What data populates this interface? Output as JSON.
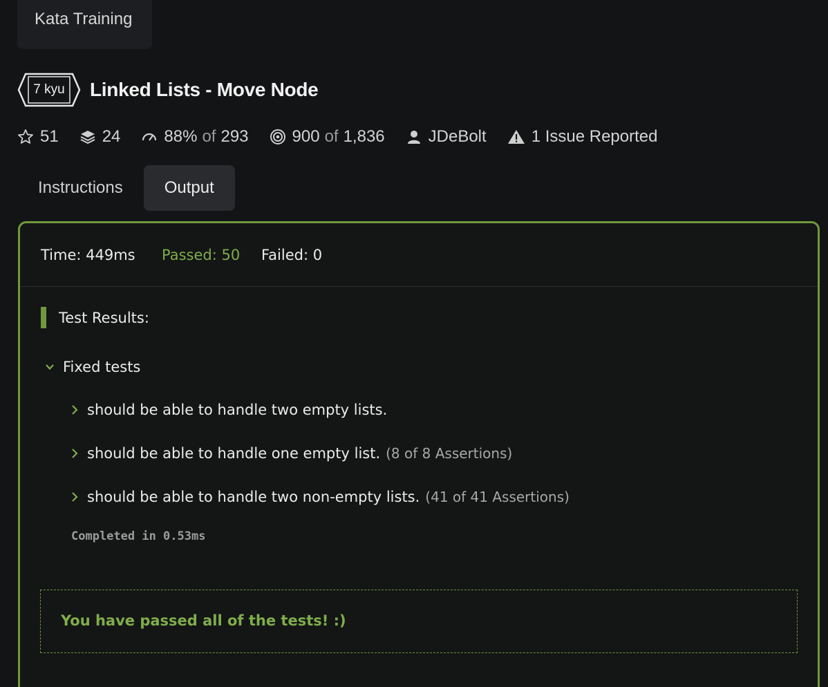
{
  "top_tab": {
    "label": "Kata Training"
  },
  "kata": {
    "rank": "7 kyu",
    "title": "Linked Lists - Move Node"
  },
  "stats": {
    "stars": "51",
    "collections": "24",
    "satisfaction_pct": "88%",
    "of_word": "of",
    "satisfaction_votes": "293",
    "completed": "900",
    "attempted": "1,836",
    "author": "JDeBolt",
    "issues": "1 Issue Reported"
  },
  "tabs": [
    {
      "label": "Instructions",
      "active": false
    },
    {
      "label": "Output",
      "active": true
    }
  ],
  "output": {
    "time": "Time: 449ms",
    "passed": "Passed: 50",
    "failed": "Failed: 0",
    "results_heading": "Test Results:",
    "group_label": "Fixed tests",
    "tests": [
      {
        "label": "should be able to handle two empty lists.",
        "assertions": ""
      },
      {
        "label": "should be able to handle one empty list.",
        "assertions": "(8 of 8 Assertions)"
      },
      {
        "label": "should be able to handle two non-empty lists.",
        "assertions": "(41 of 41 Assertions)"
      }
    ],
    "completed_in": "Completed in 0.53ms",
    "passed_message": "You have passed all of the tests! :)"
  },
  "colors": {
    "accent_green": "#6f9a3d",
    "pass_text": "#7fae4a",
    "background": "#131416"
  }
}
